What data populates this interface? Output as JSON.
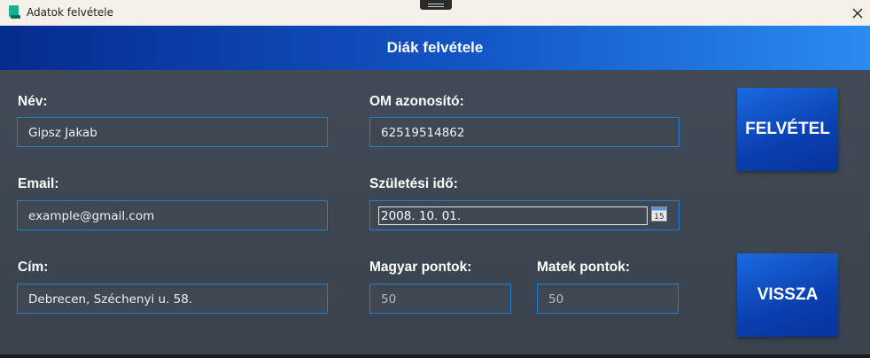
{
  "window": {
    "title": "Adatok felvétele"
  },
  "header": {
    "title": "Diák felvétele"
  },
  "form": {
    "name": {
      "label": "Név:",
      "value": "Gipsz Jakab"
    },
    "om": {
      "label": "OM azonosító:",
      "value": "62519514862"
    },
    "email": {
      "label": "Email:",
      "value": "example@gmail.com"
    },
    "birth": {
      "label": "Születési idő:",
      "value": "2008. 10. 01.",
      "calendar_day": "15"
    },
    "address": {
      "label": "Cím:",
      "value": "Debrecen, Széchenyi u. 58."
    },
    "hungarian_points": {
      "label": "Magyar pontok:",
      "value": "50"
    },
    "math_points": {
      "label": "Matek pontok:",
      "value": "50"
    }
  },
  "buttons": {
    "submit": "FELVÉTEL",
    "back": "VISSZA"
  },
  "colors": {
    "accent": "#1e7fd8",
    "header_start": "#062b8f",
    "header_end": "#2a8bf3",
    "background": "#3c4450"
  }
}
